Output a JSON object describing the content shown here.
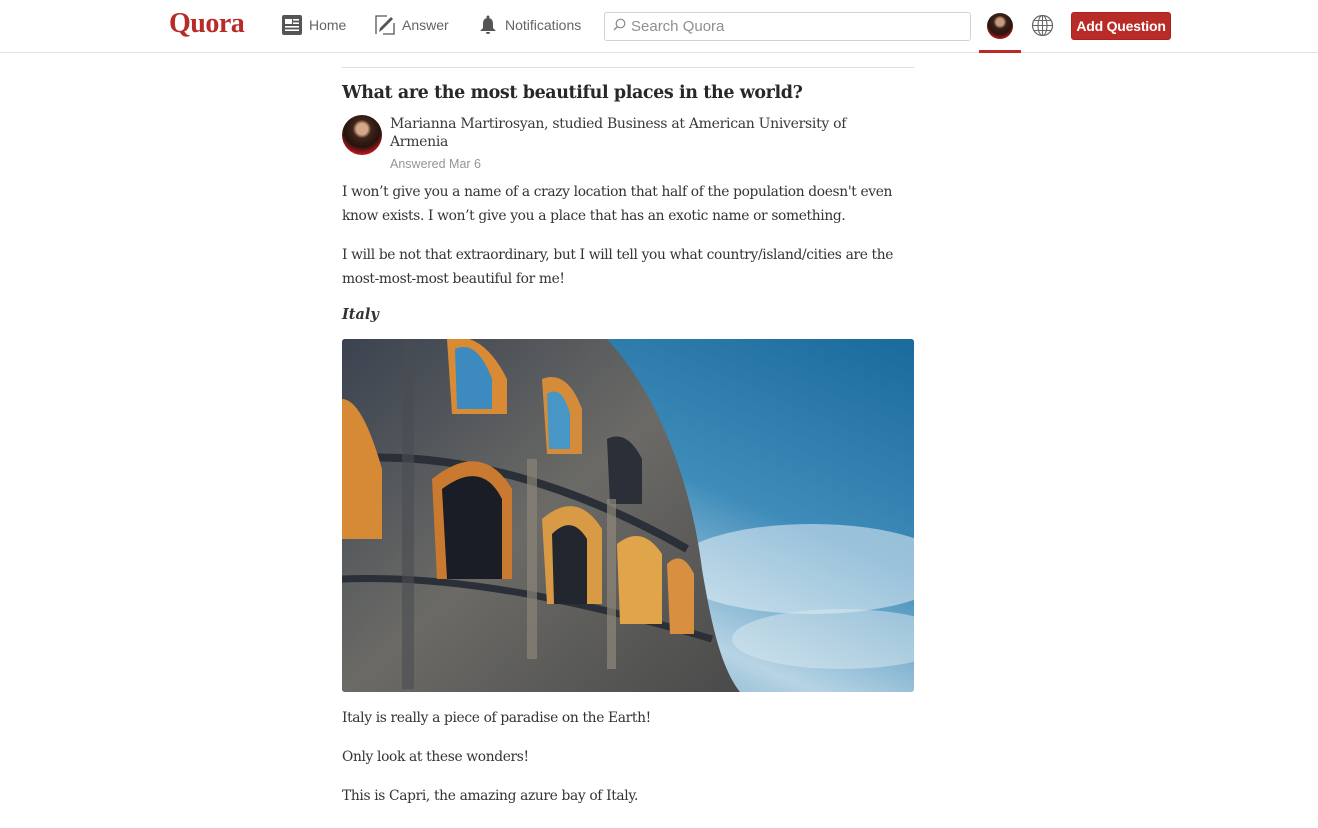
{
  "header": {
    "logo": "Quora",
    "nav": [
      {
        "label": "Home",
        "icon": "home-feed-icon"
      },
      {
        "label": "Answer",
        "icon": "pencil-edit-icon"
      },
      {
        "label": "Notifications",
        "icon": "bell-icon"
      }
    ],
    "search_placeholder": "Search Quora",
    "add_question_label": "Add Question",
    "colors": {
      "brand": "#b92b27"
    }
  },
  "question": {
    "title": "What are the most beautiful places in the world?"
  },
  "answer": {
    "author_credential": "Marianna Martirosyan, studied Business at American University of Armenia",
    "answered": "Answered Mar 6",
    "paragraphs_before": [
      "I won’t give you a name of a crazy location that half of the population doesn't even know exists. I won’t give you a place that has an exotic name or something.",
      "I will be not that extraordinary, but I will tell you what country/island/cities are the most-most-most beautiful for me!"
    ],
    "section_heading": "Italy",
    "image_alt": "Colosseum in Rome against a blue cloudy sky",
    "paragraphs_after": [
      "Italy is really a piece of paradise on the Earth!",
      "Only look at these wonders!",
      "This is Capri, the amazing azure bay of Italy."
    ]
  }
}
